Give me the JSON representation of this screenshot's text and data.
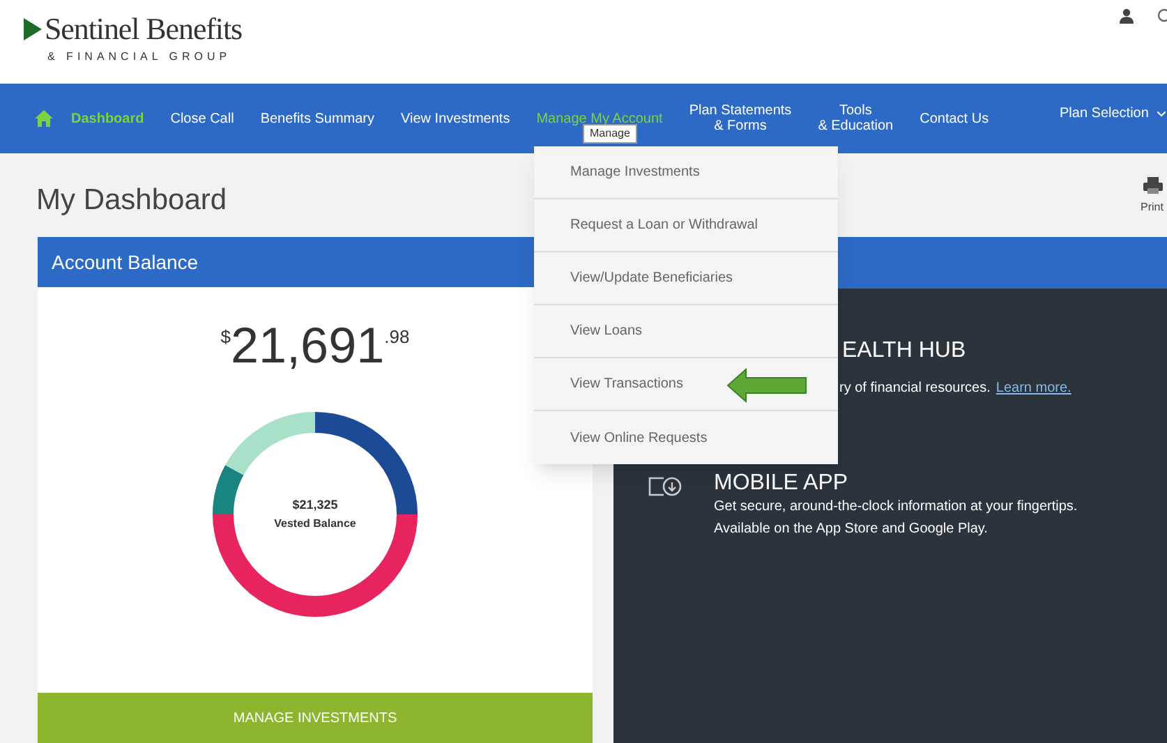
{
  "header": {
    "logo_name": "Sentinel Benefits",
    "logo_tagline": "& FINANCIAL GROUP"
  },
  "nav": {
    "items": [
      {
        "label": "Dashboard",
        "selected": true,
        "open": false
      },
      {
        "label": "Close Call",
        "selected": false,
        "open": false
      },
      {
        "label": "Benefits Summary",
        "selected": false,
        "open": false
      },
      {
        "label": "View Investments",
        "selected": false,
        "open": false
      },
      {
        "label": "Manage My Account",
        "selected": false,
        "open": true
      },
      {
        "label": "Plan Statements\n& Forms",
        "selected": false,
        "open": false
      },
      {
        "label": "Tools\n& Education",
        "selected": false,
        "open": false
      },
      {
        "label": "Contact Us",
        "selected": false,
        "open": false
      }
    ],
    "plan_selection": "Plan Selection",
    "tooltip": "Manage"
  },
  "dropdown": {
    "items": [
      "Manage Investments",
      "Request a Loan or Withdrawal",
      "View/Update Beneficiaries",
      "View Loans",
      "View Transactions",
      "View Online Requests"
    ]
  },
  "page_title": "My Dashboard",
  "print_label": "Print",
  "account_balance": {
    "title": "Account Balance",
    "currency": "$",
    "whole": "21,691",
    "cents": ".98",
    "vested_amount": "$21,325",
    "vested_label": "Vested Balance",
    "button": "MANAGE INVESTMENTS"
  },
  "learn_more": {
    "items": [
      {
        "kind": "hub",
        "heading": "EALTH HUB",
        "text": "ry of financial resources.",
        "link": "Learn more."
      },
      {
        "kind": "app",
        "heading": "MOBILE APP",
        "text": "Get secure, around-the-clock information at your fingertips. Available on the App Store and Google Play."
      }
    ]
  }
}
